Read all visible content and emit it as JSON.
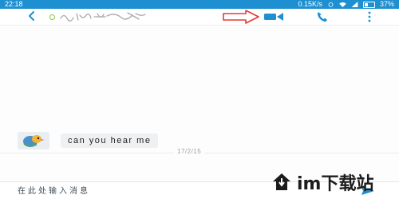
{
  "status_bar": {
    "time": "22:18",
    "net_speed": "0.15K/s",
    "battery": "37%"
  },
  "header": {
    "back_icon": "back-arrow-icon",
    "presence_icon": "presence-ring-icon",
    "contact_name_icon": "handwritten-contact-name",
    "annotation_icon": "red-arrow-icon",
    "video_icon": "video-camera-icon",
    "call_icon": "phone-icon",
    "more_icon": "more-vertical-icon"
  },
  "conversation": {
    "date": "17/2/15",
    "messages": [
      {
        "text": "can you hear me",
        "avatar_icon": "bird-avatar"
      }
    ]
  },
  "composer": {
    "placeholder": "在此处输入消息",
    "send_icon": "send-icon"
  },
  "watermark": {
    "text": "im下载站"
  },
  "colors": {
    "accent": "#1e8fd0",
    "presence": "#7fc640",
    "annotation_red": "#e53935",
    "bubble_bg": "#eef0f2"
  }
}
